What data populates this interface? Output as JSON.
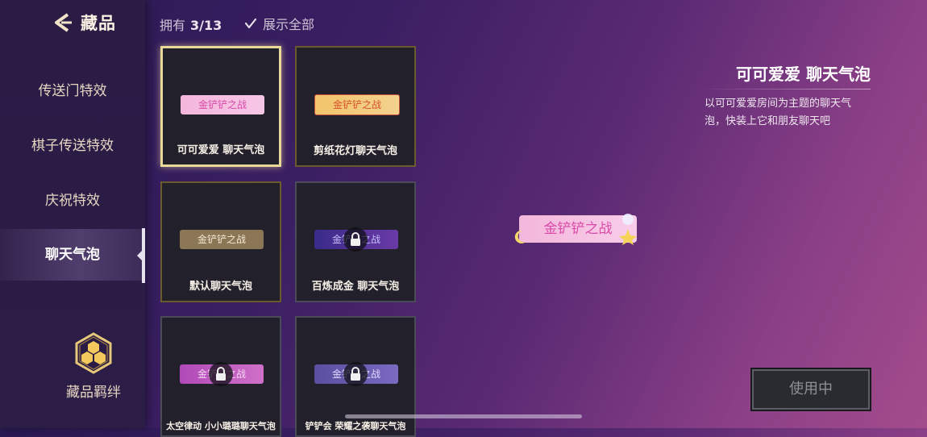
{
  "header": {
    "title": "藏品"
  },
  "sidebar": {
    "items": [
      {
        "label": "传送门特效"
      },
      {
        "label": "棋子传送特效"
      },
      {
        "label": "庆祝特效"
      },
      {
        "label": "聊天气泡"
      }
    ],
    "bond_label": "藏品羁绊"
  },
  "topbar": {
    "owned_label": "拥有",
    "owned_count": "3/13",
    "show_all_label": "展示全部",
    "show_all_checked": true
  },
  "bubble_text": "金铲铲之战",
  "cards": [
    {
      "name": "可可爱爱 聊天气泡",
      "selected": true,
      "locked": false
    },
    {
      "name": "剪纸花灯聊天气泡",
      "selected": false,
      "locked": false
    },
    {
      "name": "默认聊天气泡",
      "selected": false,
      "locked": false
    },
    {
      "name": "百炼成金 聊天气泡",
      "selected": false,
      "locked": true
    },
    {
      "name": "太空律动 小小璐璐聊天气泡",
      "selected": false,
      "locked": true
    },
    {
      "name": "铲铲会 荣耀之袭聊天气泡",
      "selected": false,
      "locked": true
    }
  ],
  "detail": {
    "title": "可可爱爱 聊天气泡",
    "description": "以可可爱爱房间为主题的聊天气泡，快装上它和朋友聊天吧",
    "preview_text": "金铲铲之战",
    "button_label": "使用中"
  },
  "colors": {
    "selected_border": "#e8d99b",
    "gold_border": "#6a5a2c",
    "accent_pink": "#d94aa8"
  }
}
